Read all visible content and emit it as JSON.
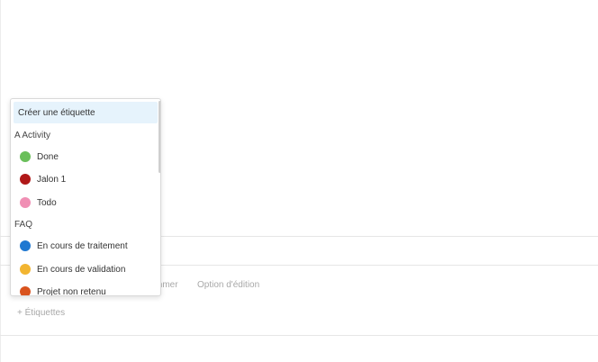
{
  "background_row": {
    "rename_partial": "mmer",
    "edit_option": "Option d'édition",
    "add_labels": "+ Étiquettes"
  },
  "dropdown": {
    "create_label": "Créer une étiquette",
    "groups": [
      {
        "title": "A Activity",
        "items": [
          {
            "label": "Done",
            "color": "#6abf5a"
          },
          {
            "label": "Jalon 1",
            "color": "#b01818"
          },
          {
            "label": "Todo",
            "color": "#f08fb4"
          }
        ]
      },
      {
        "title": "FAQ",
        "items": [
          {
            "label": "En cours de traitement",
            "color": "#1f78d1"
          },
          {
            "label": "En cours de validation",
            "color": "#f2b531"
          },
          {
            "label": "Projet non retenu",
            "color": "#d9531e"
          }
        ]
      }
    ]
  }
}
